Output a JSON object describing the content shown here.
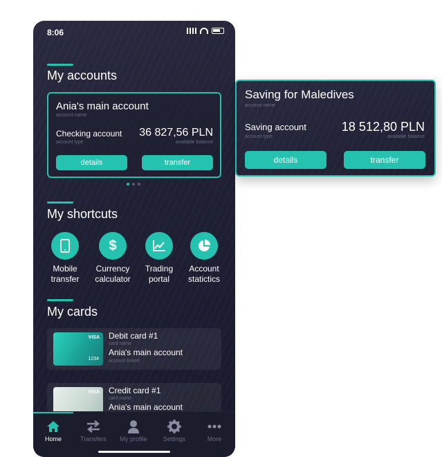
{
  "status_bar": {
    "time": "8:06"
  },
  "accounts_section": {
    "title": "My accounts",
    "card": {
      "name": "Ania's main account",
      "name_caption": "account name",
      "type": "Checking account",
      "type_caption": "account type",
      "balance": "36 827,56 PLN",
      "balance_caption": "available balance",
      "details_label": "details",
      "transfer_label": "transfer"
    },
    "carousel": {
      "pages": 3,
      "active": 1
    }
  },
  "popout_card": {
    "name": "Saving for Maledives",
    "name_caption": "account name",
    "type": "Saving account",
    "type_caption": "account type",
    "balance": "18 512,80 PLN",
    "balance_caption": "available balance",
    "details_label": "details",
    "transfer_label": "transfer"
  },
  "shortcuts_section": {
    "title": "My shortcuts",
    "items": [
      {
        "line1": "Mobile",
        "line2": "transfer",
        "icon": "phone-icon"
      },
      {
        "line1": "Currency",
        "line2": "calculator",
        "icon": "dollar-icon"
      },
      {
        "line1": "Trading",
        "line2": "portal",
        "icon": "chart-icon"
      },
      {
        "line1": "Account",
        "line2": "statictics",
        "icon": "pie-chart-icon"
      }
    ]
  },
  "cards_section": {
    "title": "My cards",
    "cards": [
      {
        "title": "Debit card #1",
        "title_caption": "card name",
        "account": "Ania's main account",
        "account_caption": "account linked",
        "brand": "VISA",
        "number": "1234"
      },
      {
        "title": "Credit card #1",
        "title_caption": "card name",
        "account": "Ania's main account",
        "brand": "VISA"
      }
    ]
  },
  "tabbar": {
    "tabs": [
      {
        "label": "Home",
        "icon": "home-icon",
        "active": true
      },
      {
        "label": "Transfers",
        "icon": "transfer-arrows-icon"
      },
      {
        "label": "My profile",
        "icon": "user-icon"
      },
      {
        "label": "Settings",
        "icon": "gear-icon"
      },
      {
        "label": "More",
        "icon": "more-dots-icon"
      }
    ]
  },
  "colors": {
    "accent": "#25c2b0",
    "background": "#1f2034",
    "muted_text": "#6a6c82"
  }
}
